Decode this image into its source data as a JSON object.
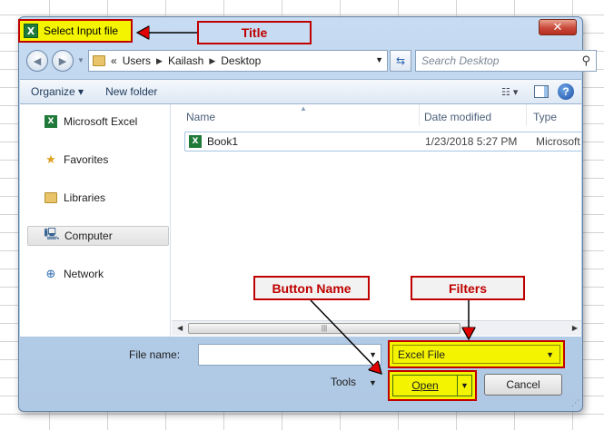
{
  "dialog": {
    "title": "Select Input file",
    "close_symbol": "✕",
    "breadcrumb": [
      "«",
      "Users",
      "Kailash",
      "Desktop"
    ],
    "search_placeholder": "Search Desktop",
    "toolbar": {
      "organize": "Organize ▾",
      "new_folder": "New folder"
    },
    "nav": [
      {
        "label": "Microsoft Excel",
        "icon": "excel-icon"
      },
      {
        "label": "Favorites",
        "icon": "star-icon"
      },
      {
        "label": "Libraries",
        "icon": "library-icon"
      },
      {
        "label": "Computer",
        "icon": "computer-icon"
      },
      {
        "label": "Network",
        "icon": "network-icon"
      }
    ],
    "columns": [
      "Name",
      "Date modified",
      "Type"
    ],
    "files": [
      {
        "name": "Book1",
        "date": "1/23/2018 5:27 PM",
        "type": "Microsoft"
      }
    ],
    "file_name_label": "File name:",
    "file_name_value": "",
    "filter": "Excel File",
    "tools": "Tools",
    "open": "Open",
    "cancel": "Cancel"
  },
  "annotations": {
    "title": "Title",
    "button_name": "Button Name",
    "filters": "Filters"
  },
  "colors": {
    "highlight": "#f4f400",
    "annotation_border": "#c00000"
  }
}
